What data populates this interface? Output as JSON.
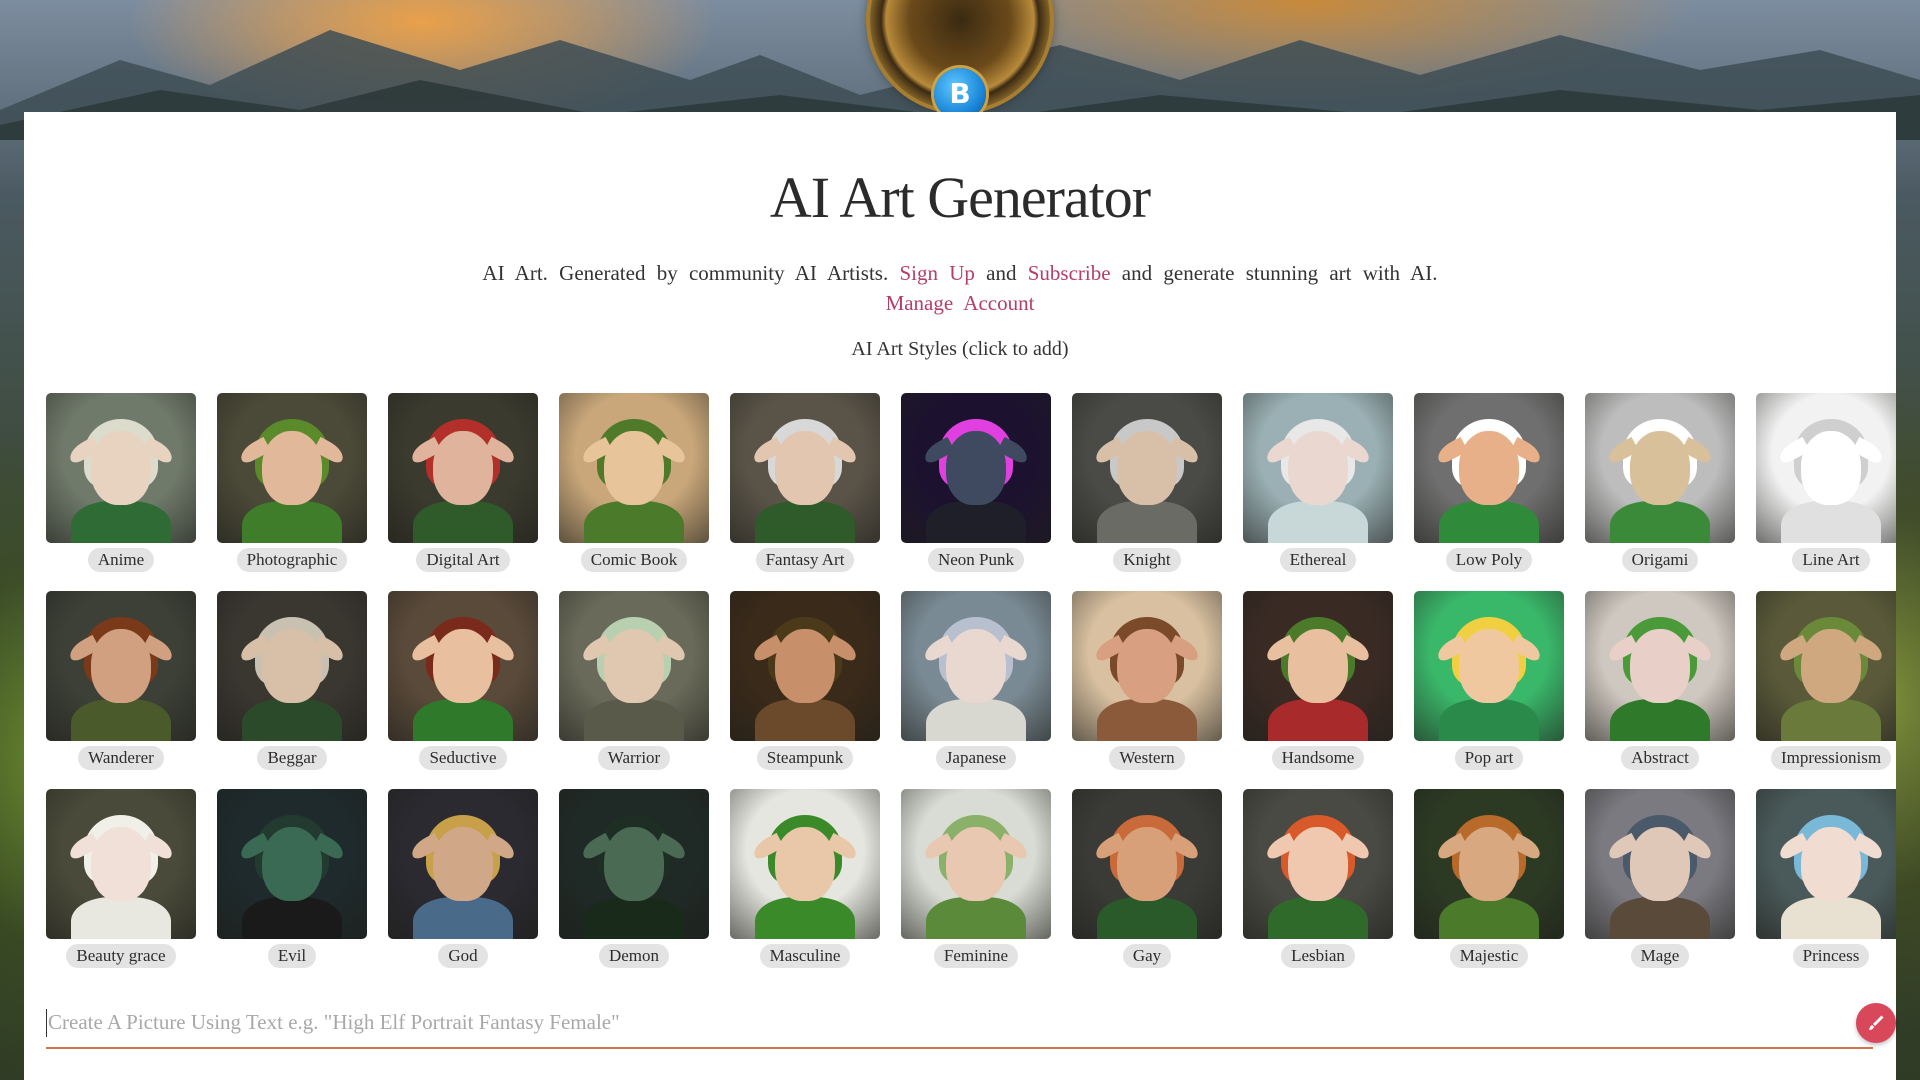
{
  "header": {
    "title": "AI Art Generator",
    "logo_letter": "B"
  },
  "intro": {
    "text_prefix": "AI Art. Generated by community AI Artists.",
    "sign_up_label": "Sign Up",
    "and_1": "and",
    "subscribe_label": "Subscribe",
    "text_suffix": "and generate stunning art with AI.",
    "manage_account_label": "Manage Account"
  },
  "styles_caption": "AI Art Styles (click to add)",
  "styles": [
    {
      "label": "Anime",
      "bg": "#6f7a6a",
      "skin": "#e8d2c0",
      "outfit": "#2f6b34",
      "hair": "#dcdccc"
    },
    {
      "label": "Photographic",
      "bg": "#4b4a38",
      "skin": "#e2b89a",
      "outfit": "#3f7d2a",
      "hair": "#5a8a2a"
    },
    {
      "label": "Digital Art",
      "bg": "#3b3a2e",
      "skin": "#e0b49c",
      "outfit": "#2f5a2a",
      "hair": "#b3302a"
    },
    {
      "label": "Comic Book",
      "bg": "#c9a77a",
      "skin": "#e7c49a",
      "outfit": "#4a7a2a",
      "hair": "#4f7a2a"
    },
    {
      "label": "Fantasy Art",
      "bg": "#5a5448",
      "skin": "#e2c6b0",
      "outfit": "#2f5a2a",
      "hair": "#d8d8d8"
    },
    {
      "label": "Neon Punk",
      "bg": "#1c1230",
      "skin": "#3f4a60",
      "outfit": "#1f1f2a",
      "hair": "#e040e0"
    },
    {
      "label": "Knight",
      "bg": "#4a4a46",
      "skin": "#d8c0a8",
      "outfit": "#6b6b66",
      "hair": "#c8c8c8"
    },
    {
      "label": "Ethereal",
      "bg": "#9ab0b4",
      "skin": "#ead8d0",
      "outfit": "#c8d8d8",
      "hair": "#e8e8e8"
    },
    {
      "label": "Low Poly",
      "bg": "#6f6f6f",
      "skin": "#e8b088",
      "outfit": "#2f8a3a",
      "hair": "#ffffff"
    },
    {
      "label": "Origami",
      "bg": "#bdbdbd",
      "skin": "#d8c09a",
      "outfit": "#3a8a3a",
      "hair": "#ffffff"
    },
    {
      "label": "Line Art",
      "bg": "#f2f2f2",
      "skin": "#ffffff",
      "outfit": "#e0e0e0",
      "hair": "#cfcfcf"
    },
    {
      "label": "Wanderer",
      "bg": "#3c4036",
      "skin": "#d0a080",
      "outfit": "#4a5a2a",
      "hair": "#7a3a1a"
    },
    {
      "label": "Beggar",
      "bg": "#3a3630",
      "skin": "#d8c0a8",
      "outfit": "#2a4a2a",
      "hair": "#c8c0b0"
    },
    {
      "label": "Seductive",
      "bg": "#5a4a3a",
      "skin": "#e8c0a0",
      "outfit": "#2f7a2a",
      "hair": "#7a2a1a"
    },
    {
      "label": "Warrior",
      "bg": "#6a6a5a",
      "skin": "#e0c8b0",
      "outfit": "#5a5a4a",
      "hair": "#b8d0b0"
    },
    {
      "label": "Steampunk",
      "bg": "#3a2a1a",
      "skin": "#c8906a",
      "outfit": "#6a4a2a",
      "hair": "#4a3a1a"
    },
    {
      "label": "Japanese",
      "bg": "#7a8a94",
      "skin": "#e8d8d0",
      "outfit": "#d8d8d0",
      "hair": "#b8c0d0"
    },
    {
      "label": "Western",
      "bg": "#d8c0a0",
      "skin": "#d8a080",
      "outfit": "#8a5a3a",
      "hair": "#7a4a2a"
    },
    {
      "label": "Handsome",
      "bg": "#3a2a24",
      "skin": "#e8c0a0",
      "outfit": "#a82a2a",
      "hair": "#4a7a2a"
    },
    {
      "label": "Pop art",
      "bg": "#3ab86a",
      "skin": "#f0c8a0",
      "outfit": "#2a8a4a",
      "hair": "#f0d040"
    },
    {
      "label": "Abstract",
      "bg": "#cfc8c0",
      "skin": "#e8d0c8",
      "outfit": "#2f7a2a",
      "hair": "#4a9a3a"
    },
    {
      "label": "Impressionism",
      "bg": "#5a5a3a",
      "skin": "#d0a880",
      "outfit": "#6a7a3a",
      "hair": "#6a8a3a"
    },
    {
      "label": "Beauty grace",
      "bg": "#4a4a3a",
      "skin": "#f0e0d8",
      "outfit": "#e8e8e0",
      "hair": "#f0f0e8"
    },
    {
      "label": "Evil",
      "bg": "#1e2a2c",
      "skin": "#3a6a54",
      "outfit": "#1a1a1a",
      "hair": "#223a30"
    },
    {
      "label": "God",
      "bg": "#2a2a30",
      "skin": "#d0a888",
      "outfit": "#4a6a8a",
      "hair": "#c8a04a"
    },
    {
      "label": "Demon",
      "bg": "#1f2a26",
      "skin": "#4a6a54",
      "outfit": "#1a2a1a",
      "hair": "#1e2e24"
    },
    {
      "label": "Masculine",
      "bg": "#e6e6e0",
      "skin": "#e8c8a8",
      "outfit": "#3a8a2a",
      "hair": "#3a8a2a"
    },
    {
      "label": "Feminine",
      "bg": "#d8dcd4",
      "skin": "#e8c8b0",
      "outfit": "#5a8a3a",
      "hair": "#8ab06a"
    },
    {
      "label": "Gay",
      "bg": "#3a3a36",
      "skin": "#d8a078",
      "outfit": "#2a5a2a",
      "hair": "#c86a3a"
    },
    {
      "label": "Lesbian",
      "bg": "#4a4a44",
      "skin": "#f0c8b0",
      "outfit": "#2f6a2a",
      "hair": "#d85a2a"
    },
    {
      "label": "Majestic",
      "bg": "#2c3a24",
      "skin": "#d8a880",
      "outfit": "#4a7a2a",
      "hair": "#b86a2a"
    },
    {
      "label": "Mage",
      "bg": "#7a7a80",
      "skin": "#e0c8b8",
      "outfit": "#5a4a3a",
      "hair": "#4a5a6a"
    },
    {
      "label": "Princess",
      "bg": "#4a5a5a",
      "skin": "#f0dcd0",
      "outfit": "#e8e0d0",
      "hair": "#7ab8d8"
    }
  ],
  "prompt": {
    "placeholder": "Create A Picture Using Text e.g. \"High Elf Portrait Fantasy Female\""
  },
  "colors": {
    "link": "#b33e6a",
    "accent_underline": "#d2734a",
    "go_button": "#d9475a"
  }
}
